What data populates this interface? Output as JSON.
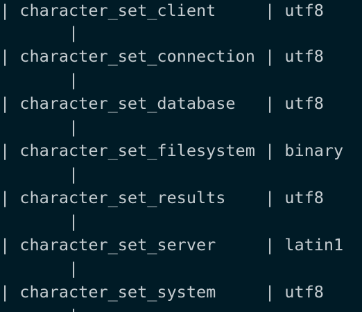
{
  "terminal": {
    "lines": [
      {
        "kind": "row",
        "text": "| character_set_client     | utf8"
      },
      {
        "kind": "wrap",
        "text": "       |"
      },
      {
        "kind": "row",
        "text": "| character_set_connection | utf8"
      },
      {
        "kind": "wrap",
        "text": "       |"
      },
      {
        "kind": "row",
        "text": "| character_set_database   | utf8"
      },
      {
        "kind": "wrap",
        "text": "       |"
      },
      {
        "kind": "row",
        "text": "| character_set_filesystem | binary"
      },
      {
        "kind": "wrap",
        "text": "       |"
      },
      {
        "kind": "row",
        "text": "| character_set_results    | utf8"
      },
      {
        "kind": "wrap",
        "text": "       |"
      },
      {
        "kind": "row",
        "text": "| character_set_server     | latin1"
      },
      {
        "kind": "wrap",
        "text": "       |"
      },
      {
        "kind": "row",
        "text": "| character_set_system     | utf8"
      },
      {
        "kind": "wrap",
        "text": "       |"
      }
    ]
  },
  "colors": {
    "background": "#001b26",
    "text": "#c5ccd0"
  }
}
